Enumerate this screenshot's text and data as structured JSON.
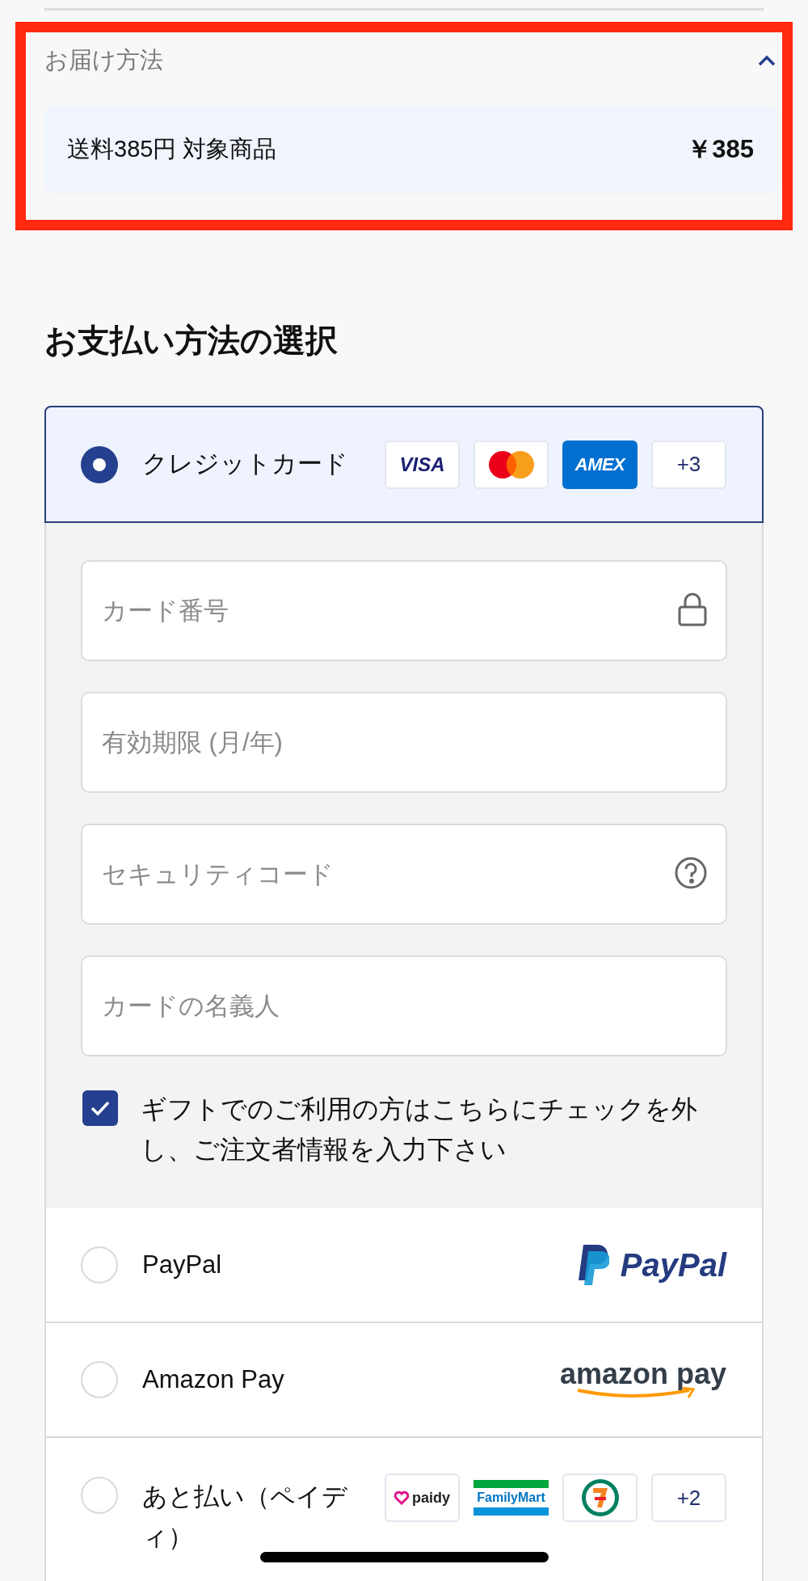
{
  "delivery": {
    "highlighted": true,
    "title": "お届け方法",
    "expanded": true,
    "option": {
      "label": "送料385円 対象商品",
      "price": "￥385"
    }
  },
  "payment": {
    "title": "お支払い方法の選択",
    "methods": [
      {
        "kind": "card",
        "label": "クレジットカード",
        "selected": true,
        "badges": [
          {
            "kind": "visa",
            "text": "VISA"
          },
          {
            "kind": "mastercard"
          },
          {
            "kind": "amex",
            "text": "AMEX"
          },
          {
            "kind": "more",
            "text": "+3"
          }
        ],
        "fields": [
          {
            "kind": "card_number",
            "placeholder": "カード番号"
          },
          {
            "kind": "expiry",
            "placeholder": "有効期限 (月/年)"
          },
          {
            "kind": "cvc",
            "placeholder": "セキュリティコード"
          },
          {
            "kind": "name",
            "placeholder": "カードの名義人"
          }
        ],
        "gift": {
          "label": "ギフトでのご利用の方はこちらにチェックを外し、ご注文者情報を入力下さい",
          "checked": true
        }
      },
      {
        "kind": "logo",
        "label": "PayPal",
        "selected": false,
        "logo": {
          "kind": "paypal",
          "text": "PayPal"
        }
      },
      {
        "kind": "logo",
        "label": "Amazon Pay",
        "selected": false,
        "logo": {
          "kind": "amazon_pay",
          "text": "amazon pay"
        }
      },
      {
        "kind": "badges",
        "label": "あと払い（ペイディ）",
        "selected": false,
        "badges": [
          {
            "kind": "paidy",
            "text": "paidy"
          },
          {
            "kind": "familymart",
            "text": "FamilyMart"
          },
          {
            "kind": "seven_eleven"
          },
          {
            "kind": "more",
            "text": "+2"
          }
        ]
      }
    ]
  }
}
